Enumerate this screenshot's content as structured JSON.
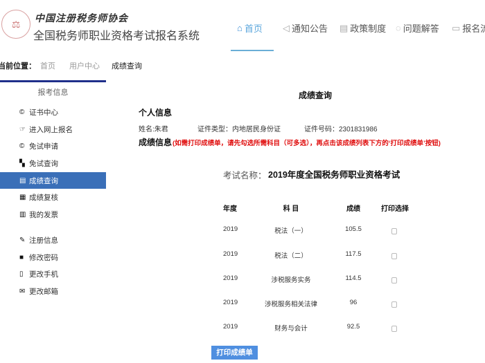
{
  "header": {
    "logo_text": "中国注册税务师协会",
    "site_title": "全国税务师职业资格考试报名系统",
    "nav": [
      {
        "label": "首页",
        "icon": "home-icon",
        "active": true
      },
      {
        "label": "通知公告",
        "icon": "megaphone-icon"
      },
      {
        "label": "政策制度",
        "icon": "document-icon"
      },
      {
        "label": "问题解答",
        "icon": "question-icon"
      },
      {
        "label": "报名流",
        "icon": "register-icon"
      }
    ]
  },
  "breadcrumb": {
    "label": "当前位置：",
    "items": [
      "首页",
      "用户中心",
      "成绩查询"
    ]
  },
  "sidebar": {
    "heading": "报考信息",
    "items": [
      {
        "label": "证书中心",
        "icon": "certificate-icon"
      },
      {
        "label": "进入网上报名",
        "icon": "hand-pointer-icon"
      },
      {
        "label": "免试申请",
        "icon": "copyright-icon"
      },
      {
        "label": "免试查询",
        "icon": "files-icon"
      },
      {
        "label": "成绩查询",
        "icon": "list-icon",
        "active": true
      },
      {
        "label": "成绩复核",
        "icon": "list-alt-icon"
      },
      {
        "label": "我的发票",
        "icon": "barcode-icon"
      },
      {
        "label": "注册信息",
        "icon": "wrench-icon"
      },
      {
        "label": "修改密码",
        "icon": "lock-icon"
      },
      {
        "label": "更改手机",
        "icon": "mobile-icon"
      },
      {
        "label": "更改邮箱",
        "icon": "envelope-icon"
      }
    ]
  },
  "main": {
    "title": "成绩查询",
    "personal_heading": "个人信息",
    "name": "姓名:朱君",
    "id_type": "证件类型：内地居民身份证",
    "id_number": "证件号码：2301831986",
    "score_heading": "成绩信息",
    "score_note": "(如需打印成绩单，请先勾选所需科目（可多选），再点击该成绩列表下方的‘打印成绩单’按钮)",
    "exam_label": "考试名称：",
    "exam_name": "2019年度全国税务师职业资格考试",
    "columns": [
      "年度",
      "科 目",
      "成绩",
      "打印选择"
    ],
    "rows": [
      {
        "year": "2019",
        "subject": "税法（一）",
        "score": "105.5"
      },
      {
        "year": "2019",
        "subject": "税法（二）",
        "score": "117.5"
      },
      {
        "year": "2019",
        "subject": "涉税服务实务",
        "score": "114.5"
      },
      {
        "year": "2019",
        "subject": "涉税服务相关法律",
        "score": "96"
      },
      {
        "year": "2019",
        "subject": "财务与会计",
        "score": "92.5"
      }
    ],
    "print_button": "打印成绩单"
  },
  "colors": {
    "accent": "#3a6fb8",
    "note": "#e01010",
    "button": "#4f8fe0"
  }
}
